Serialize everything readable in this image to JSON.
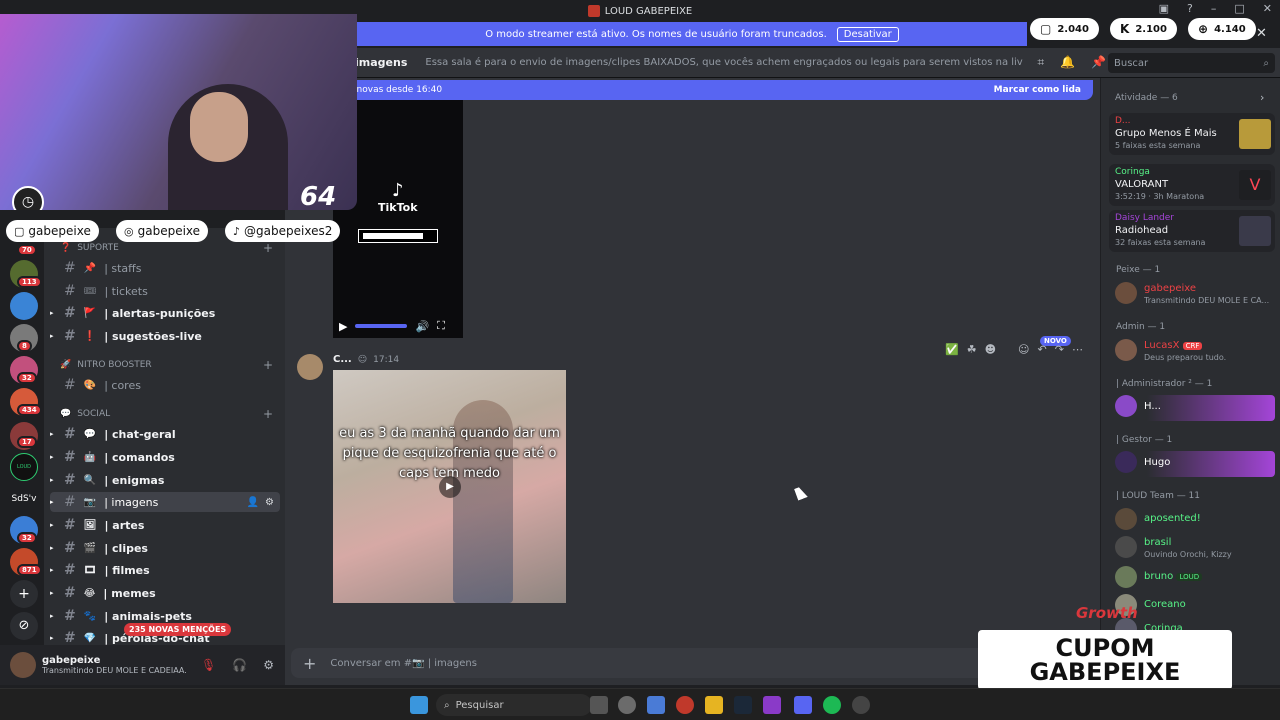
{
  "window": {
    "title": "LOUD GABEPEIXE"
  },
  "streamer_bar": {
    "message": "O modo streamer está ativo. Os nomes de usuário foram truncados.",
    "button": "Desativar"
  },
  "counters": [
    {
      "icon": "speech-icon",
      "value": "2.040"
    },
    {
      "icon": "kick-icon",
      "value": "2.100"
    },
    {
      "icon": "globe-icon",
      "value": "4.140"
    }
  ],
  "channel": {
    "name": "imagens",
    "topic": "Essa sala é para o envio de imagens/clipes BAIXADOS, que vocês achem engraçados ou legais para serem vistos na live. Serão apagados prints de ou...",
    "search_placeholder": "Buscar"
  },
  "new_messages": {
    "text": "s novas desde 16:40",
    "action": "Marcar como lida"
  },
  "video1": {
    "brand": "TikTok"
  },
  "message2": {
    "author": "C...",
    "time": "17:14",
    "caption": "eu as 3 da manhã quando dar um pique de esquizofrenia que até o caps tem medo",
    "badge": "NOVO"
  },
  "composer": {
    "placeholder": "Conversar em #📷 | imagens"
  },
  "socials": [
    {
      "icon": "twitch-icon",
      "handle": "gabepeixe"
    },
    {
      "icon": "instagram-icon",
      "handle": "gabepeixe"
    },
    {
      "icon": "tiktok-icon",
      "handle": "@gabepeixes2"
    }
  ],
  "webcam": {
    "overlay_number": "64"
  },
  "guild_badges": [
    "70",
    "113",
    "8",
    "32",
    "434",
    "17",
    "32",
    "871"
  ],
  "guild_labels": {
    "loud": "LOUD",
    "sds": "SdS'v"
  },
  "categories": [
    {
      "label": "SUPORTE"
    },
    {
      "label": "NITRO BOOSTER"
    },
    {
      "label": "SOCIAL"
    }
  ],
  "channels": [
    {
      "emoji": "📌",
      "label": "| staffs"
    },
    {
      "emoji": "🎟",
      "label": "| tickets"
    },
    {
      "emoji": "🚩",
      "label": "| alertas-punições"
    },
    {
      "emoji": "❗",
      "label": "| sugestões-live"
    },
    {
      "emoji": "🎨",
      "label": "| cores"
    },
    {
      "emoji": "💬",
      "label": "| chat-geral"
    },
    {
      "emoji": "🤖",
      "label": "| comandos"
    },
    {
      "emoji": "🔍",
      "label": "| enigmas"
    },
    {
      "emoji": "📷",
      "label": "| imagens"
    },
    {
      "emoji": "🖼",
      "label": "| artes"
    },
    {
      "emoji": "🎬",
      "label": "| clipes"
    },
    {
      "emoji": "🎞",
      "label": "| filmes"
    },
    {
      "emoji": "😂",
      "label": "| memes"
    },
    {
      "emoji": "🐾",
      "label": "| animais-pets"
    },
    {
      "emoji": "💎",
      "label": "| pérolas-do-chat"
    }
  ],
  "mentions_badge": "235 NOVAS MENÇÕES",
  "user_panel": {
    "name": "gabepeixe",
    "status": "Transmitindo DEU MOLE E CADEIAA..."
  },
  "activity": {
    "header": "Atividade — 6",
    "cards": [
      {
        "user": "D...",
        "title": "Grupo Menos É Mais",
        "meta": "5 faixas esta semana"
      },
      {
        "user": "Coringa",
        "title": "VALORANT",
        "meta": "3:52:19  ·  3h Maratona"
      },
      {
        "user": "Daisy Lander",
        "title": "Radiohead",
        "meta": "32 faixas esta semana"
      }
    ]
  },
  "roles": [
    {
      "header": "Peixe — 1",
      "members": [
        {
          "name": "gabepeixe",
          "sub": "Transmitindo DEU MOLE E CA...",
          "color": "#ed4245"
        }
      ]
    },
    {
      "header": "Admin — 1",
      "members": [
        {
          "name": "LucasX",
          "tag": "CRF",
          "sub": "Deus preparou tudo.",
          "color": "#ed4245"
        }
      ]
    },
    {
      "header": "| Administrador ² — 1",
      "members": [
        {
          "name": "H...",
          "color": "#ffffff"
        }
      ]
    },
    {
      "header": "| Gestor — 1",
      "members": [
        {
          "name": "Hugo",
          "color": "#ffffff"
        }
      ]
    },
    {
      "header": "| LOUD Team — 11",
      "members": [
        {
          "name": "aposented!",
          "color": "#57f287"
        },
        {
          "name": "brasil",
          "sub": "Ouvindo Orochi, Kizzy",
          "color": "#57f287"
        },
        {
          "name": "bruno",
          "tag": "LOUD",
          "color": "#57f287"
        },
        {
          "name": "Coreano",
          "color": "#57f287"
        },
        {
          "name": "Coringa",
          "color": "#57f287"
        }
      ]
    }
  ],
  "overlay": {
    "growth": "Growth",
    "cupom_line1": "CUPOM",
    "cupom_line2": "GABEPEIXE"
  },
  "taskbar": {
    "search_placeholder": "Pesquisar"
  }
}
